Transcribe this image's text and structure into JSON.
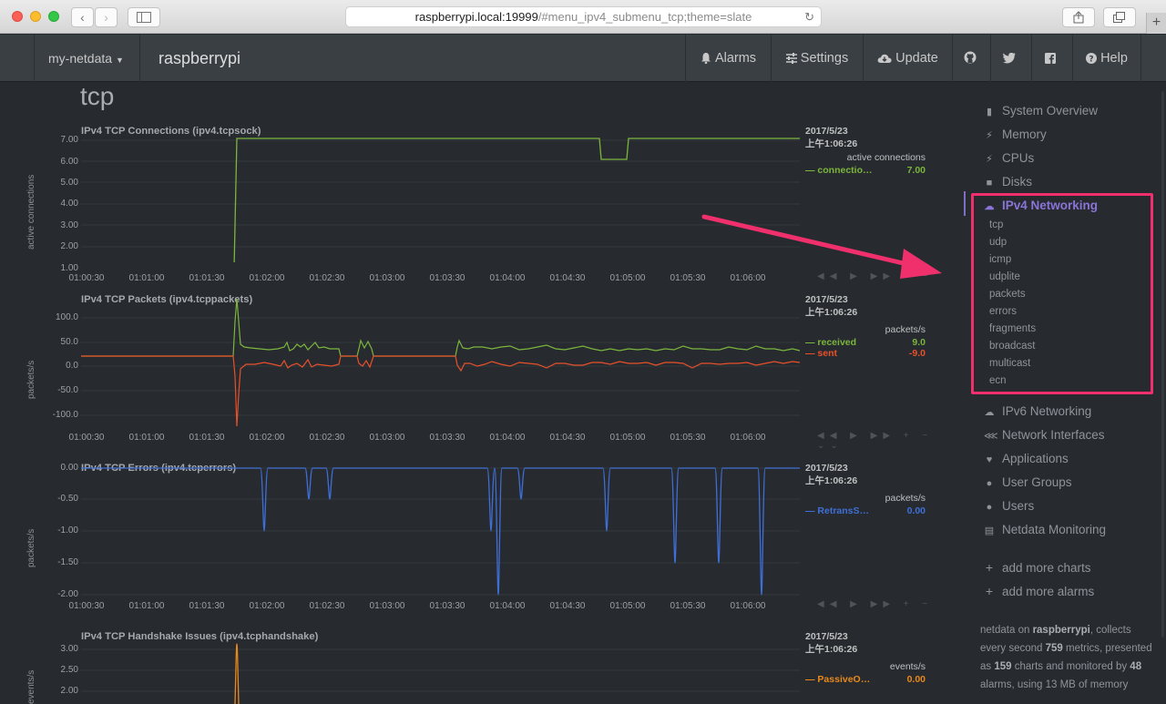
{
  "browser": {
    "url_host": "raspberrypi.local:19999",
    "url_path": "/#menu_ipv4_submenu_tcp;theme=slate"
  },
  "navbar": {
    "brand_dropdown": "my-netdata",
    "hostname": "raspberrypi",
    "items": [
      {
        "label": "Alarms",
        "icon": "bell-icon"
      },
      {
        "label": "Settings",
        "icon": "sliders-icon"
      },
      {
        "label": "Update",
        "icon": "cloud-download-icon"
      },
      {
        "label": "",
        "icon": "github-icon"
      },
      {
        "label": "",
        "icon": "twitter-icon"
      },
      {
        "label": "",
        "icon": "facebook-icon"
      },
      {
        "label": "Help",
        "icon": "question-icon"
      }
    ]
  },
  "section_title": "tcp",
  "charts": [
    {
      "title": "IPv4 TCP Connections (ipv4.tcpsock)",
      "ylabel": "active connections",
      "yticks": [
        "7.00",
        "6.00",
        "5.00",
        "4.00",
        "3.00",
        "2.00",
        "1.00"
      ],
      "xticks": [
        "01:00:30",
        "01:01:00",
        "01:01:30",
        "01:02:00",
        "01:02:30",
        "01:03:00",
        "01:03:30",
        "01:04:00",
        "01:04:30",
        "01:05:00",
        "01:05:30",
        "01:06:00"
      ],
      "legend": {
        "date": "2017/5/23",
        "time": "上午1:06:26",
        "units": "active connections",
        "dims": [
          {
            "name": "connectio…",
            "value": "7.00",
            "color": "#7cb53c"
          }
        ]
      }
    },
    {
      "title": "IPv4 TCP Packets (ipv4.tcppackets)",
      "ylabel": "packets/s",
      "yticks": [
        "100.0",
        "50.0",
        "0.0",
        "-50.0",
        "-100.0"
      ],
      "xticks": [
        "01:00:30",
        "01:01:00",
        "01:01:30",
        "01:02:00",
        "01:02:30",
        "01:03:00",
        "01:03:30",
        "01:04:00",
        "01:04:30",
        "01:05:00",
        "01:05:30",
        "01:06:00"
      ],
      "legend": {
        "date": "2017/5/23",
        "time": "上午1:06:26",
        "units": "packets/s",
        "dims": [
          {
            "name": "received",
            "value": "9.0",
            "color": "#7cb53c"
          },
          {
            "name": "sent",
            "value": "-9.0",
            "color": "#e8502a"
          }
        ]
      }
    },
    {
      "title": "IPv4 TCP Errors (ipv4.tcperrors)",
      "ylabel": "packets/s",
      "yticks": [
        "0.00",
        "-0.50",
        "-1.00",
        "-1.50",
        "-2.00"
      ],
      "xticks": [
        "01:00:30",
        "01:01:00",
        "01:01:30",
        "01:02:00",
        "01:02:30",
        "01:03:00",
        "01:03:30",
        "01:04:00",
        "01:04:30",
        "01:05:00",
        "01:05:30",
        "01:06:00"
      ],
      "legend": {
        "date": "2017/5/23",
        "time": "上午1:06:26",
        "units": "packets/s",
        "dims": [
          {
            "name": "RetransS…",
            "value": "0.00",
            "color": "#3f6fd6"
          }
        ]
      }
    },
    {
      "title": "IPv4 TCP Handshake Issues (ipv4.tcphandshake)",
      "ylabel": "events/s",
      "yticks": [
        "3.00",
        "2.50",
        "2.00"
      ],
      "xticks": [],
      "legend": {
        "date": "2017/5/23",
        "time": "上午1:06:26",
        "units": "events/s",
        "dims": [
          {
            "name": "PassiveO…",
            "value": "0.00",
            "color": "#e8891c"
          }
        ]
      }
    }
  ],
  "sidebar": {
    "menu": [
      {
        "label": "System Overview",
        "icon": "bookmark-icon"
      },
      {
        "label": "Memory",
        "icon": "bolt-icon"
      },
      {
        "label": "CPUs",
        "icon": "bolt-icon"
      },
      {
        "label": "Disks",
        "icon": "folder-icon"
      },
      {
        "label": "IPv4 Networking",
        "icon": "cloud-icon"
      }
    ],
    "submenu": [
      "tcp",
      "udp",
      "icmp",
      "udplite",
      "packets",
      "errors",
      "fragments",
      "broadcast",
      "multicast",
      "ecn"
    ],
    "menu2": [
      {
        "label": "IPv6 Networking",
        "icon": "cloud-icon"
      },
      {
        "label": "Network Interfaces",
        "icon": "share-icon"
      },
      {
        "label": "Applications",
        "icon": "heartbeat-icon"
      },
      {
        "label": "User Groups",
        "icon": "users-icon"
      },
      {
        "label": "Users",
        "icon": "user-icon"
      },
      {
        "label": "Netdata Monitoring",
        "icon": "bar-chart-icon"
      }
    ],
    "add_charts": "add more charts",
    "add_alarms": "add more alarms",
    "info": {
      "t1": "netdata on ",
      "host": "raspberrypi",
      "t2": ", collects every second ",
      "metrics": "759",
      "t3": " metrics, presented as ",
      "charts": "159",
      "t4": " charts and monitored by ",
      "alarms": "48",
      "t5": " alarms, using 13 MB of memory"
    }
  },
  "colors": {
    "accent": "#8b74d6",
    "highlight": "#f0306d"
  }
}
